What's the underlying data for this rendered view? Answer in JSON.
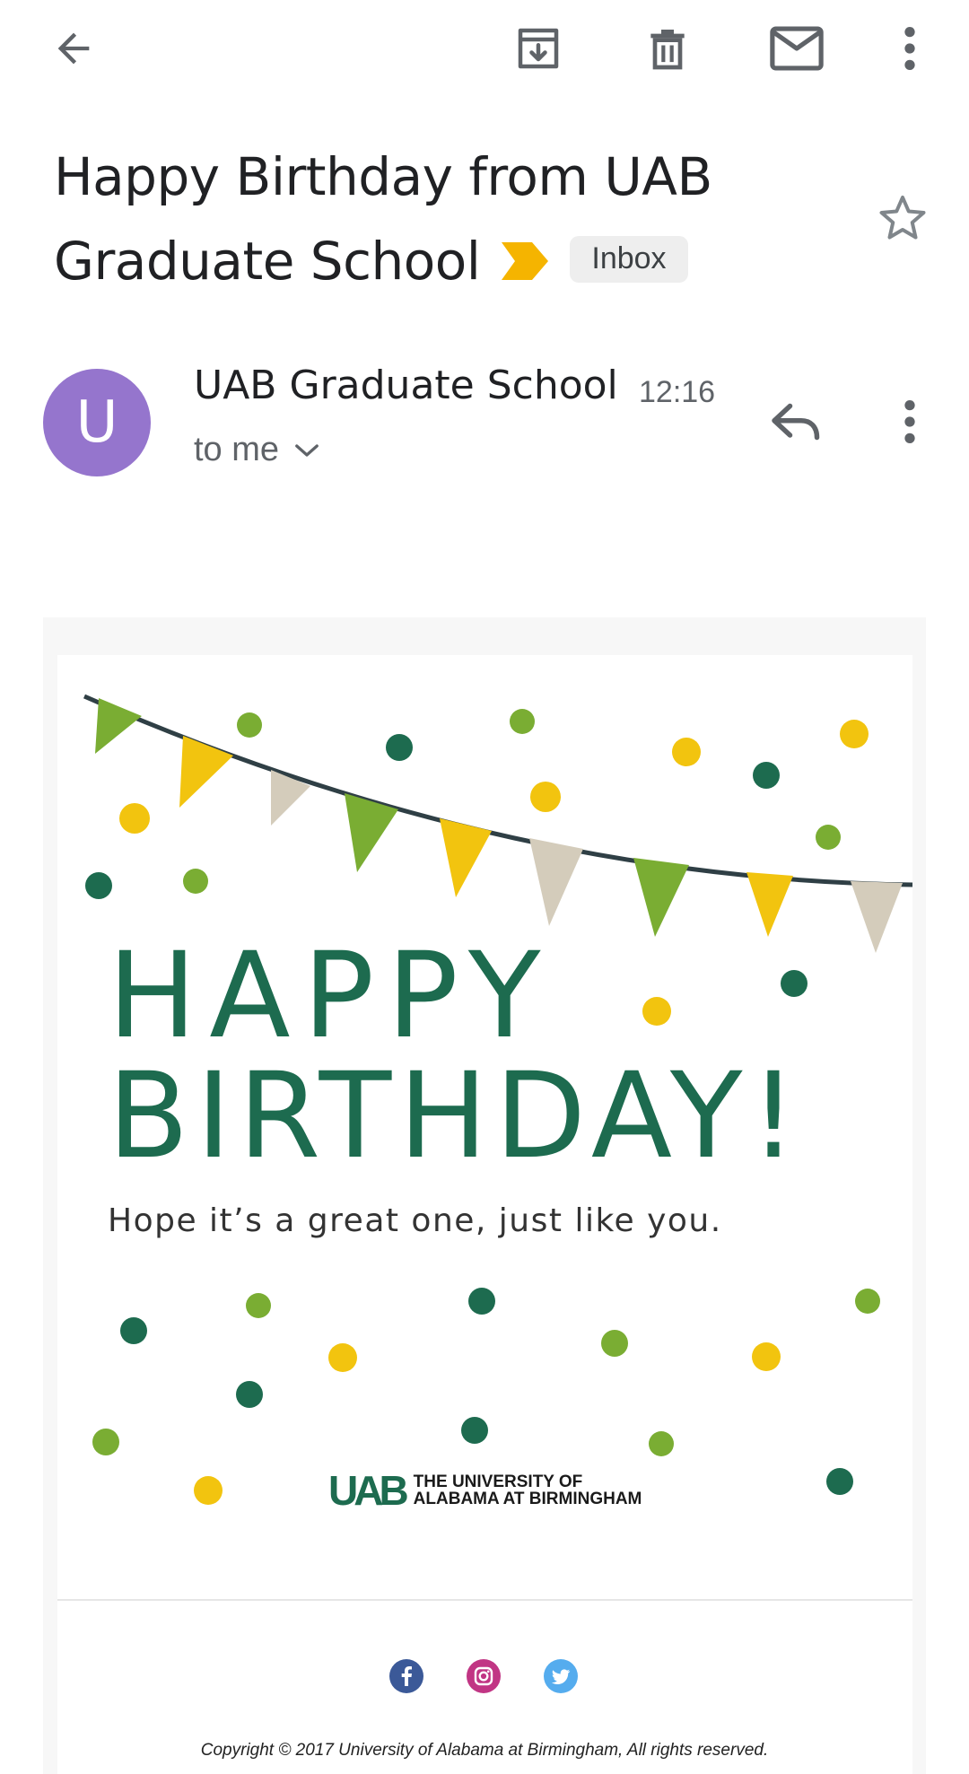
{
  "toolbar": {
    "back_icon": "arrow-back-icon",
    "archive_icon": "archive-icon",
    "delete_icon": "trash-icon",
    "mark_unread_icon": "mail-icon",
    "more_icon": "more-vert-icon"
  },
  "email": {
    "subject_line1": "Happy Birthday from UAB",
    "subject_line2": "Graduate School",
    "importance_color": "#f5b400",
    "label": "Inbox",
    "starred": false
  },
  "sender": {
    "avatar_letter": "U",
    "avatar_color": "#9575cd",
    "name": "UAB Graduate School",
    "time": "12:16",
    "recipient": "to me"
  },
  "message": {
    "headline_1": "HAPPY",
    "headline_2": "BIRTHDAY!",
    "tagline": "Hope it’s a great one, just like you.",
    "logo_mark": "UAB",
    "logo_line1": "THE UNIVERSITY OF",
    "logo_line2": "ALABAMA AT BIRMINGHAM",
    "brand_color": "#1d6b4f",
    "social": [
      "facebook-icon",
      "instagram-icon",
      "twitter-icon"
    ],
    "copyright": "Copyright © 2017 University of Alabama at Birmingham, All rights reserved."
  }
}
